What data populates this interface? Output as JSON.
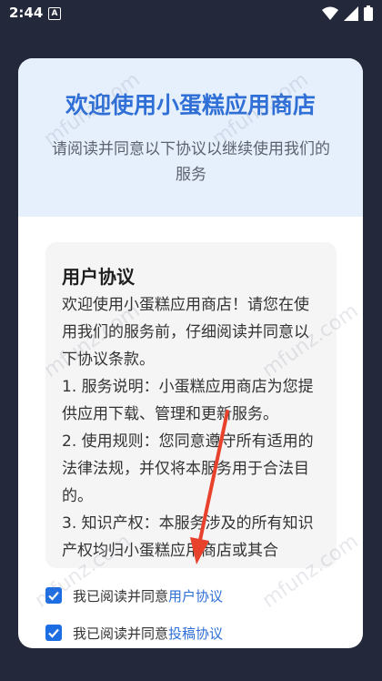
{
  "status": {
    "time": "2:44",
    "badge": "A"
  },
  "dialog": {
    "title": "欢迎使用小蛋糕应用商店",
    "subtitle": "请阅读并同意以下协议以继续使用我们的服务"
  },
  "agreement": {
    "title": "用户协议",
    "paragraphs": [
      "欢迎使用小蛋糕应用商店！请您在使用我们的服务前，仔细阅读并同意以下协议条款。",
      "1. 服务说明：小蛋糕应用商店为您提供应用下载、管理和更新服务。",
      "2. 使用规则：您同意遵守所有适用的法律法规，并仅将本服务用于合法目的。",
      "3. 知识产权：本服务涉及的所有知识产权均归小蛋糕应用商店或其合"
    ]
  },
  "checks": [
    {
      "prefix": "我已阅读并同意",
      "link": "用户协议"
    },
    {
      "prefix": "我已阅读并同意",
      "link": "投稿协议"
    }
  ],
  "watermark": "mfunz.com",
  "colors": {
    "accent": "#2f6fd6",
    "checkbox": "#1e6ee3",
    "arrow": "#e8412c"
  }
}
